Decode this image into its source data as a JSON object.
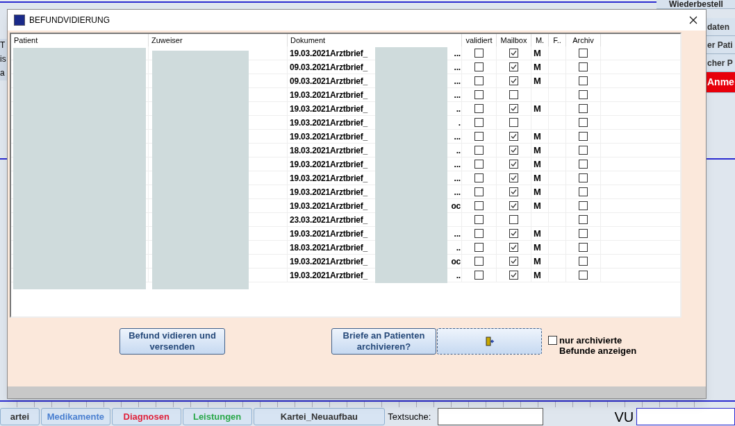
{
  "background_app": {
    "side_buttons": [
      {
        "label": "Wiederbestell",
        "kind": "plain"
      },
      {
        "label": "daten",
        "kind": "plain"
      },
      {
        "label": "er Pati",
        "kind": "plain"
      },
      {
        "label": "cher P",
        "kind": "plain"
      },
      {
        "label": "Anme",
        "kind": "alert"
      }
    ],
    "left_fragments": [
      "T",
      "is",
      "a"
    ],
    "bottom_tabs": [
      {
        "label": "artei",
        "color": "#333333"
      },
      {
        "label": "Medikamente",
        "color": "#4a7fd0"
      },
      {
        "label": "Diagnosen",
        "color": "#e0203a"
      },
      {
        "label": "Leistungen",
        "color": "#2aa84a"
      },
      {
        "label": "Kartei_Neuaufbau",
        "color": "#333333"
      }
    ],
    "search_label": "Textsuche:",
    "vu_label": "VU"
  },
  "dialog": {
    "title": "BEFUNDVIDIERUNG",
    "table": {
      "columns": [
        "Patient",
        "Zuweiser",
        "Dokument",
        "validiert",
        "Mailbox",
        "M.",
        "F..",
        "Archiv"
      ],
      "rows": [
        {
          "document": "19.03.2021Arztbrief_",
          "document_end": "...",
          "validiert": false,
          "mailbox": true,
          "m": "M",
          "archiv": false
        },
        {
          "document": "09.03.2021Arztbrief_",
          "document_end": "...",
          "validiert": false,
          "mailbox": true,
          "m": "M",
          "archiv": false
        },
        {
          "document": "09.03.2021Arztbrief_",
          "document_end": "...",
          "validiert": false,
          "mailbox": true,
          "m": "M",
          "archiv": false
        },
        {
          "document": "19.03.2021Arztbrief_",
          "document_end": "...",
          "validiert": false,
          "mailbox": false,
          "archiv": false
        },
        {
          "document": "19.03.2021Arztbrief_",
          "document_end": "..",
          "validiert": false,
          "mailbox": true,
          "m": "M",
          "archiv": false
        },
        {
          "document": "19.03.2021Arztbrief_",
          "document_end": ".",
          "validiert": false,
          "mailbox": false,
          "archiv": false
        },
        {
          "document": "19.03.2021Arztbrief_",
          "document_end": "...",
          "validiert": false,
          "mailbox": true,
          "m": "M",
          "archiv": false
        },
        {
          "document": "18.03.2021Arztbrief_",
          "document_end": "..",
          "validiert": false,
          "mailbox": true,
          "m": "M",
          "archiv": false
        },
        {
          "document": "19.03.2021Arztbrief_",
          "document_end": "...",
          "validiert": false,
          "mailbox": true,
          "m": "M",
          "archiv": false
        },
        {
          "document": "19.03.2021Arztbrief_",
          "document_end": "...",
          "validiert": false,
          "mailbox": true,
          "m": "M",
          "archiv": false
        },
        {
          "document": "19.03.2021Arztbrief_",
          "document_end": "...",
          "validiert": false,
          "mailbox": true,
          "m": "M",
          "archiv": false
        },
        {
          "document": "19.03.2021Arztbrief_",
          "document_end": "oc",
          "validiert": false,
          "mailbox": true,
          "m": "M",
          "archiv": false
        },
        {
          "document": "23.03.2021Arztbrief_",
          "validiert": false,
          "mailbox": false,
          "archiv": false
        },
        {
          "document": "19.03.2021Arztbrief_",
          "document_end": "...",
          "validiert": false,
          "mailbox": true,
          "m": "M",
          "archiv": false
        },
        {
          "document": "18.03.2021Arztbrief_",
          "document_end": "..",
          "validiert": false,
          "mailbox": true,
          "m": "M",
          "archiv": false
        },
        {
          "document": "19.03.2021Arztbrief_",
          "document_end": "oc",
          "validiert": false,
          "mailbox": true,
          "m": "M",
          "archiv": false
        },
        {
          "document": "19.03.2021Arztbrief_",
          "document_end": "..",
          "validiert": false,
          "mailbox": true,
          "m": "M",
          "archiv": false
        }
      ]
    },
    "buttons": [
      "Befund vidieren und versenden",
      "Briefe an Patienten archivieren?"
    ],
    "archive_filter": {
      "label": "nur archivierte Befunde anzeigen",
      "checked": false
    }
  }
}
